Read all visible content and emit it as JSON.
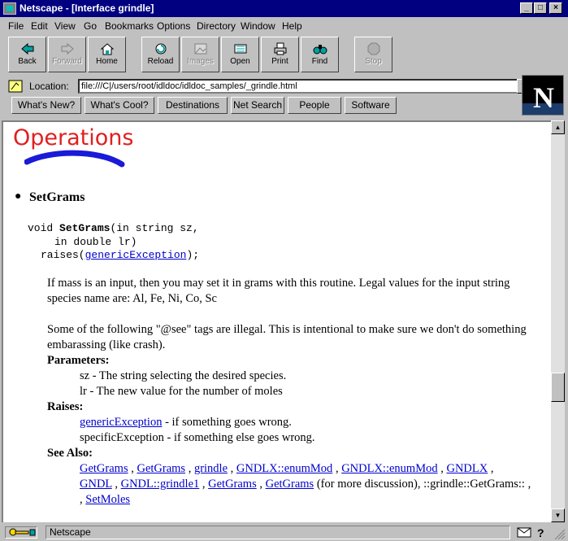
{
  "window": {
    "title": "Netscape - [Interface grindle]"
  },
  "menu": [
    "File",
    "Edit",
    "View",
    "Go",
    "Bookmarks",
    "Options",
    "Directory",
    "Window",
    "Help"
  ],
  "toolbar": {
    "back": "Back",
    "forward": "Forward",
    "home": "Home",
    "reload": "Reload",
    "images": "Images",
    "open": "Open",
    "print": "Print",
    "find": "Find",
    "stop": "Stop"
  },
  "location": {
    "label": "Location:",
    "url": "file:///C|/users/root/idldoc/idldoc_samples/_grindle.html"
  },
  "directory_buttons": [
    "What's New?",
    "What's Cool?",
    "Destinations",
    "Net Search",
    "People",
    "Software"
  ],
  "page": {
    "section_title": "Operations",
    "method": "SetGrams",
    "signature": {
      "line1_pre": "void ",
      "line1_name": "SetGrams",
      "line1_post": "(in string sz,",
      "line2": "in double lr)",
      "line3_pre": "raises(",
      "line3_link": "genericException",
      "line3_post": ");"
    },
    "desc1_a": "If mass is an input, then you may set it in grams with this routine. Legal values for the input string",
    "desc1_b": "species name are: Al, Fe, Ni, Co, Sc",
    "desc2_a": "Some of the following \"@see\" tags are illegal. This is intentional to make sure we don't do something",
    "desc2_b": "embarassing (like crash).",
    "parameters_label": "Parameters:",
    "param1": "sz - The string selecting the desired species.",
    "param2": "lr - The new value for the number of moles",
    "raises_label": "Raises:",
    "raise1_link": "genericException",
    "raise1_text": " - if something goes wrong.",
    "raise2": "specificException - if something else goes wrong.",
    "see_also_label": "See Also:",
    "see1": [
      "GetGrams",
      "GetGrams",
      "grindle",
      "GNDLX::enumMod",
      "GNDLX::enumMod",
      "GNDLX"
    ],
    "see2": [
      "GNDL",
      "GNDL::grindle1",
      "GetGrams",
      "GetGrams"
    ],
    "see2_tail": "(for more discussion), ::grindle::GetGrams:: ,",
    "see3_link": "SetMoles"
  },
  "status": {
    "text": "Netscape"
  }
}
